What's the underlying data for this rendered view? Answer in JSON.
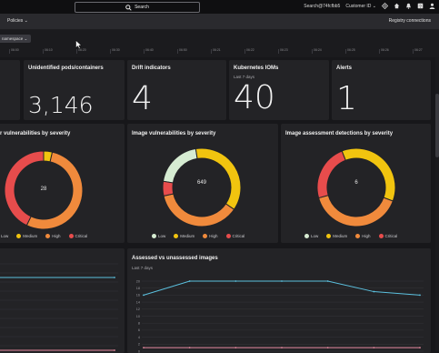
{
  "topbar": {
    "search_label": "Search",
    "user": "Search@74fcfbb5",
    "customer_id_label": "Customer ID"
  },
  "subbar": {
    "policies_label": "Policies",
    "registry_label": "Registry connections"
  },
  "filter": {
    "chip_label": "namespace",
    "timeline_ticks": [
      "06:00",
      "06:10",
      "06:20",
      "06:30",
      "06:40",
      "06:50",
      "06:21",
      "06:22",
      "06:23",
      "06:24",
      "06:25",
      "06:26",
      "06:27"
    ]
  },
  "cards": {
    "unidentified": {
      "title": "Unidentified pods/containers",
      "value": "3,146"
    },
    "drift": {
      "title": "Drift indicators",
      "value": "4"
    },
    "ioms": {
      "title": "Kubernetes IOMs",
      "subtitle": "Last 7 days",
      "value": "40"
    },
    "alerts": {
      "title": "Alerts",
      "value": "1"
    },
    "container_vuln": {
      "title": "r vulnerabilities by severity",
      "center": "28"
    },
    "image_vuln": {
      "title": "Image vulnerabilities by severity",
      "center": "649"
    },
    "image_assess": {
      "title": "Image assessment detections by severity",
      "center": "6"
    },
    "assessed": {
      "title": "Assessed vs unassessed images",
      "subtitle": "Last 7 days"
    }
  },
  "legend": {
    "low": "Low",
    "medium": "Medium",
    "high": "High",
    "critical": "Critical"
  },
  "colors": {
    "low": "#d6ecd2",
    "medium": "#f1c40f",
    "high": "#f08a3c",
    "critical": "#e74c4c",
    "line_cyan": "#5bc0de",
    "line_pink": "#e88aa0"
  },
  "chart_data": [
    {
      "type": "pie",
      "title": "r vulnerabilities by severity",
      "center_label": "28",
      "categories": [
        "Low",
        "Medium",
        "High",
        "Critical"
      ],
      "values": [
        0,
        1,
        15,
        12
      ]
    },
    {
      "type": "pie",
      "title": "Image vulnerabilities by severity",
      "center_label": "649",
      "categories": [
        "Low",
        "Medium",
        "High",
        "Critical"
      ],
      "values": [
        130,
        240,
        240,
        39
      ]
    },
    {
      "type": "pie",
      "title": "Image assessment detections by severity",
      "center_label": "6",
      "categories": [
        "Low",
        "Medium",
        "High",
        "Critical"
      ],
      "values": [
        0,
        2.2,
        2.4,
        1.4
      ]
    },
    {
      "type": "line",
      "title": "Assessed vs unassessed images",
      "subtitle": "Last 7 days",
      "y_ticks": [
        0,
        2,
        4,
        6,
        8,
        10,
        12,
        14,
        16,
        18,
        20
      ],
      "ylim": [
        0,
        20
      ],
      "x": [
        0,
        1,
        2,
        3,
        4,
        5,
        6
      ],
      "series": [
        {
          "values": [
            16,
            20,
            20,
            20,
            20,
            17,
            16
          ]
        },
        {
          "values": [
            1,
            1,
            1,
            1,
            1,
            1,
            1
          ]
        }
      ]
    },
    {
      "type": "line",
      "x": [
        0,
        1
      ],
      "ylim": [
        0,
        20
      ],
      "series": [
        {
          "values": [
            17,
            17
          ]
        },
        {
          "values": [
            1,
            1
          ]
        }
      ]
    }
  ]
}
